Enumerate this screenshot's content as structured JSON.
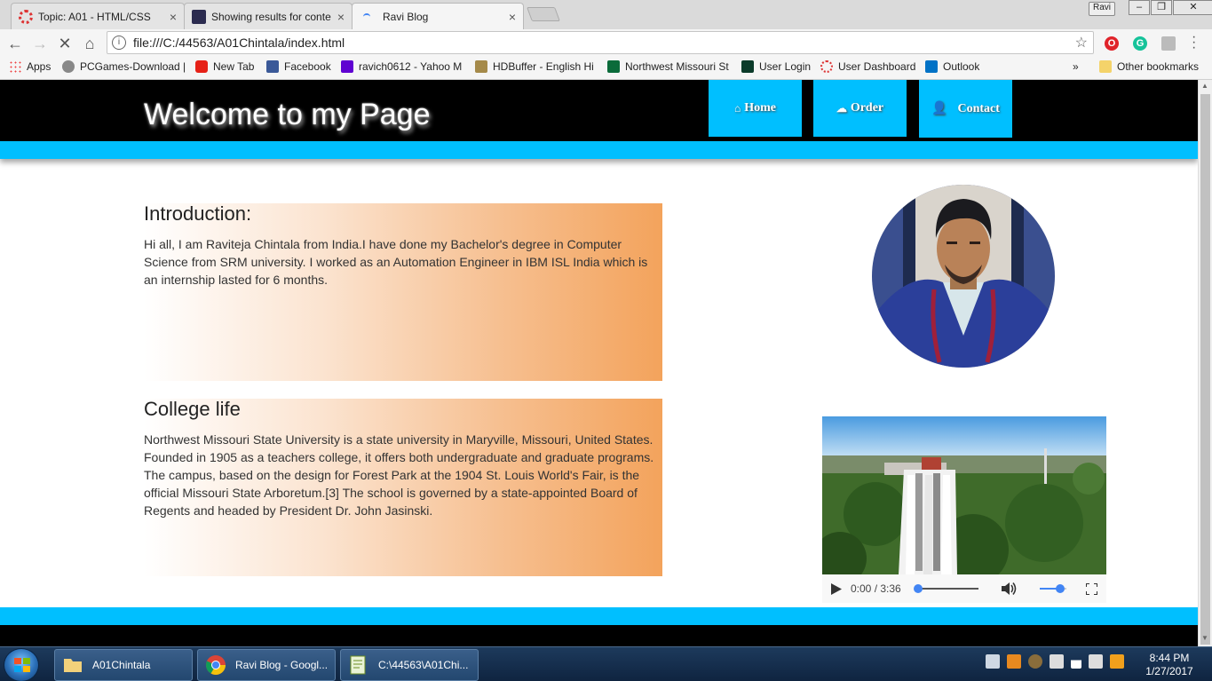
{
  "browser": {
    "tabs": [
      {
        "title": "Topic: A01 - HTML/CSS",
        "close": "×"
      },
      {
        "title": "Showing results for conte",
        "close": "×"
      },
      {
        "title": "Ravi Blog",
        "close": "×"
      }
    ],
    "profile_name": "Ravi",
    "window_buttons": {
      "minimize": "–",
      "restore": "❐",
      "close": "✕"
    },
    "url": "file:///C:/44563/A01Chintala/index.html",
    "bookmarks": [
      "Apps",
      "PCGames-Download |",
      "New Tab",
      "Facebook",
      "ravich0612 - Yahoo M",
      "HDBuffer - English Hi",
      "Northwest Missouri St",
      "User Login",
      "User Dashboard",
      "Outlook"
    ],
    "bookmarks_overflow": "»",
    "other_bookmarks": "Other bookmarks"
  },
  "page": {
    "site_title": "Welcome to my Page",
    "nav": [
      {
        "label": "Home",
        "icon": "home-icon"
      },
      {
        "label": "Order",
        "icon": "cloud-icon"
      },
      {
        "label": "Contact",
        "icon": "user-icon"
      }
    ],
    "sections": [
      {
        "heading": "Introduction:",
        "body": "Hi all, I am Raviteja Chintala from India.I have done my Bachelor's degree in Computer Science from SRM university. I worked as an Automation Engineer in IBM ISL India which is an internship lasted for 6 months."
      },
      {
        "heading": "College life",
        "body": "Northwest Missouri State University is a state university in Maryville, Missouri, United States. Founded in 1905 as a teachers college, it offers both undergraduate and graduate programs. The campus, based on the design for Forest Park at the 1904 St. Louis World's Fair, is the official Missouri State Arboretum.[3] The school is governed by a state-appointed Board of Regents and headed by President Dr. John Jasinski."
      }
    ],
    "video": {
      "time": "0:00 / 3:36",
      "progress": 0,
      "volume": 0.75
    },
    "colors": {
      "accent": "#00bfff",
      "header_bg": "#000000",
      "gradient_end": "#f3a35c"
    }
  },
  "taskbar": {
    "tasks": [
      {
        "label": "A01Chintala"
      },
      {
        "label": "Ravi Blog - Googl..."
      },
      {
        "label": "C:\\44563\\A01Chi..."
      }
    ],
    "time": "8:44 PM",
    "date": "1/27/2017"
  }
}
